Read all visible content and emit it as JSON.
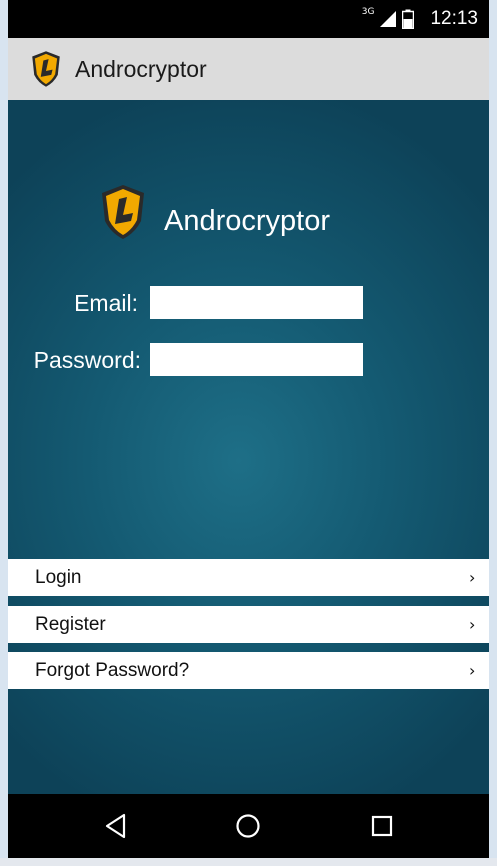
{
  "status_bar": {
    "network_type": "3G",
    "time": "12:13",
    "signal_icon": "signal-icon",
    "battery_icon": "battery-icon"
  },
  "action_bar": {
    "title": "Androcryptor",
    "logo_icon": "shield-logo-icon"
  },
  "brand": {
    "title": "Androcryptor",
    "logo_icon": "shield-logo-icon"
  },
  "form": {
    "email_label": "Email:",
    "email_value": "",
    "password_label": "Password:",
    "password_value": ""
  },
  "menu": {
    "items": [
      {
        "label": "Login",
        "icon": "chevron-right-icon"
      },
      {
        "label": "Register",
        "icon": "chevron-right-icon"
      },
      {
        "label": "Forgot Password?",
        "icon": "chevron-right-icon"
      }
    ]
  },
  "nav_bar": {
    "back_icon": "back-triangle-icon",
    "home_icon": "home-circle-icon",
    "recents_icon": "recents-square-icon"
  },
  "colors": {
    "background_center": "#1e6f87",
    "background_edge": "#0d4258",
    "action_bar": "#dcdcdc",
    "logo_shield": "#f2a900"
  }
}
